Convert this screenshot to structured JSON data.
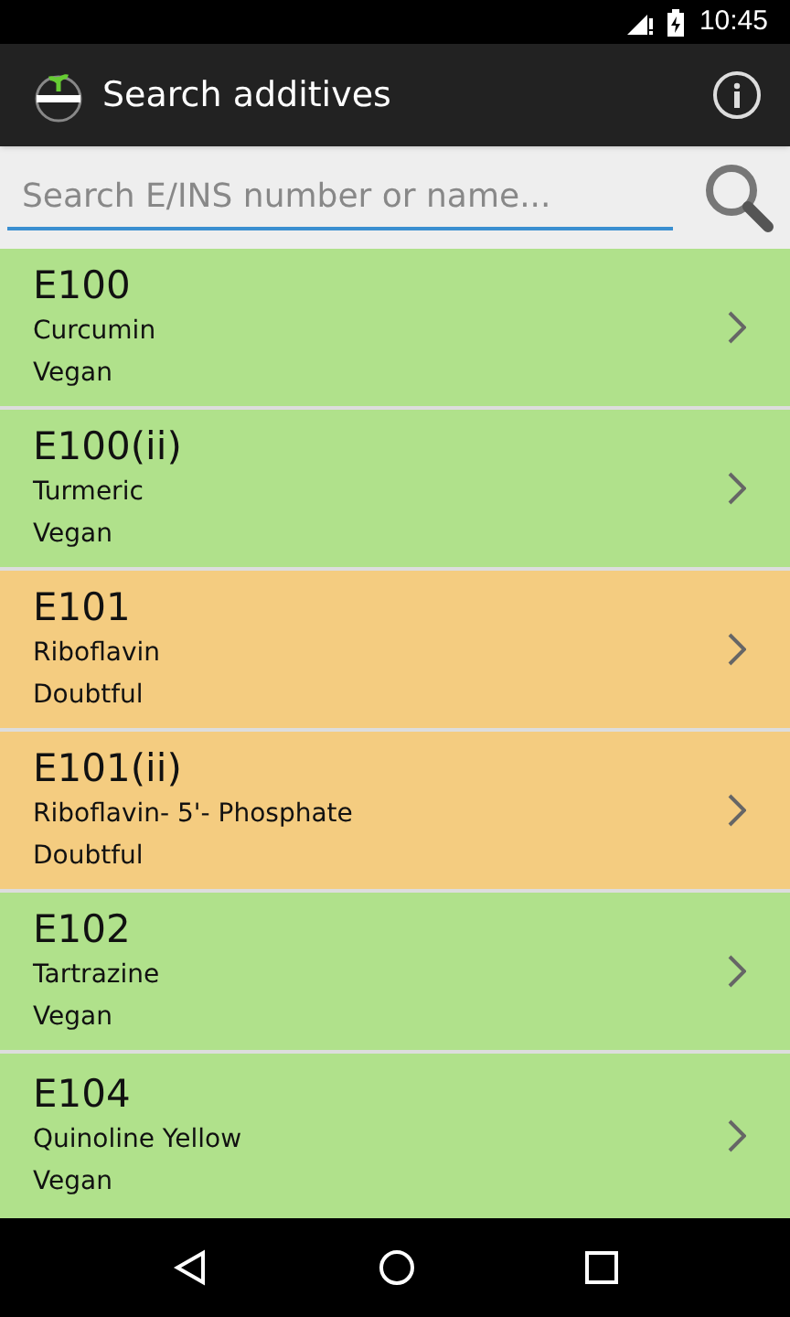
{
  "status_bar": {
    "time": "10:45"
  },
  "app_bar": {
    "title": "Search additives"
  },
  "search": {
    "placeholder": "Search E/INS number or name..."
  },
  "additives": [
    {
      "code": "E100",
      "name": "Curcumin",
      "status": "Vegan",
      "color": "#b0e18b"
    },
    {
      "code": "E100(ii)",
      "name": "Turmeric",
      "status": "Vegan",
      "color": "#b0e18b"
    },
    {
      "code": "E101",
      "name": "Riboflavin",
      "status": "Doubtful",
      "color": "#f4cc80"
    },
    {
      "code": "E101(ii)",
      "name": "Riboflavin- 5'- Phosphate",
      "status": "Doubtful",
      "color": "#f4cc80"
    },
    {
      "code": "E102",
      "name": "Tartrazine",
      "status": "Vegan",
      "color": "#b0e18b"
    },
    {
      "code": "E104",
      "name": "Quinoline Yellow",
      "status": "Vegan",
      "color": "#b0e18b"
    }
  ]
}
